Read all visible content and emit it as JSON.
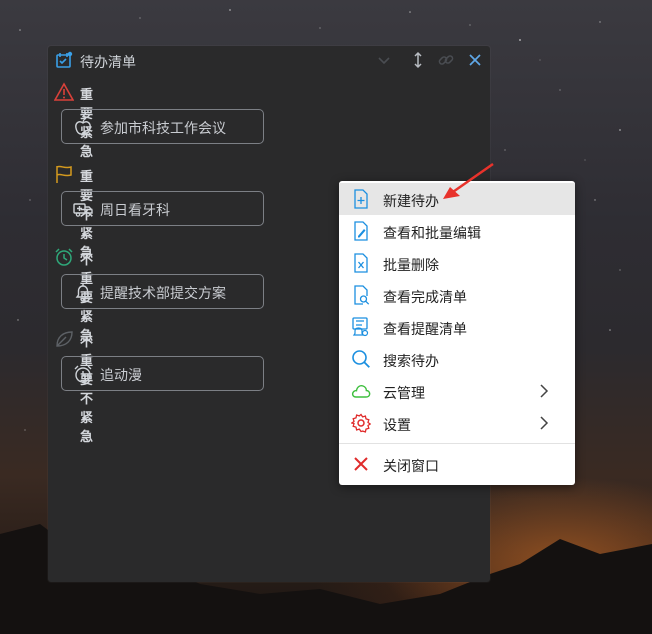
{
  "app": {
    "title": "待办清单",
    "icons": {
      "app": "todo-app-icon",
      "collapse": "chevron-down-icon",
      "pin": "pin-icon",
      "link": "link-icon",
      "close": "close-icon"
    }
  },
  "sections": [
    {
      "title": "重要紧急",
      "icon": "warning-triangle-icon",
      "color": "#d9413a",
      "items": [
        {
          "label": "参加市科技工作会议",
          "icon": "apple-icon"
        }
      ]
    },
    {
      "title": "重要不紧急",
      "icon": "flag-icon",
      "color": "#d49a1e",
      "items": [
        {
          "label": "周日看牙科",
          "icon": "medical-truck-icon"
        }
      ]
    },
    {
      "title": "不重要紧急",
      "icon": "alarm-clock-icon",
      "color": "#2fa87a",
      "items": [
        {
          "label": "提醒技术部提交方案",
          "icon": "bell-icon"
        }
      ]
    },
    {
      "title": "不重要不紧急",
      "icon": "leaf-icon",
      "color": "#6b6f74",
      "items": [
        {
          "label": "追动漫",
          "icon": "alarm-clock-icon"
        }
      ]
    }
  ],
  "context_menu": {
    "items": [
      {
        "label": "新建待办",
        "icon": "new-file-icon",
        "hovered": true
      },
      {
        "label": "查看和批量编辑",
        "icon": "edit-file-icon"
      },
      {
        "label": "批量删除",
        "icon": "delete-file-icon"
      },
      {
        "label": "查看完成清单",
        "icon": "search-file-icon"
      },
      {
        "label": "查看提醒清单",
        "icon": "reminder-file-icon"
      },
      {
        "label": "搜索待办",
        "icon": "search-icon"
      },
      {
        "label": "云管理",
        "icon": "cloud-icon",
        "submenu": true
      },
      {
        "label": "设置",
        "icon": "gear-icon",
        "submenu": true
      },
      {
        "label": "关闭窗口",
        "icon": "close-x-icon"
      }
    ],
    "colors": {
      "blue": "#1b8fe0",
      "green": "#3fbf3f",
      "red": "#e02b2b"
    }
  }
}
